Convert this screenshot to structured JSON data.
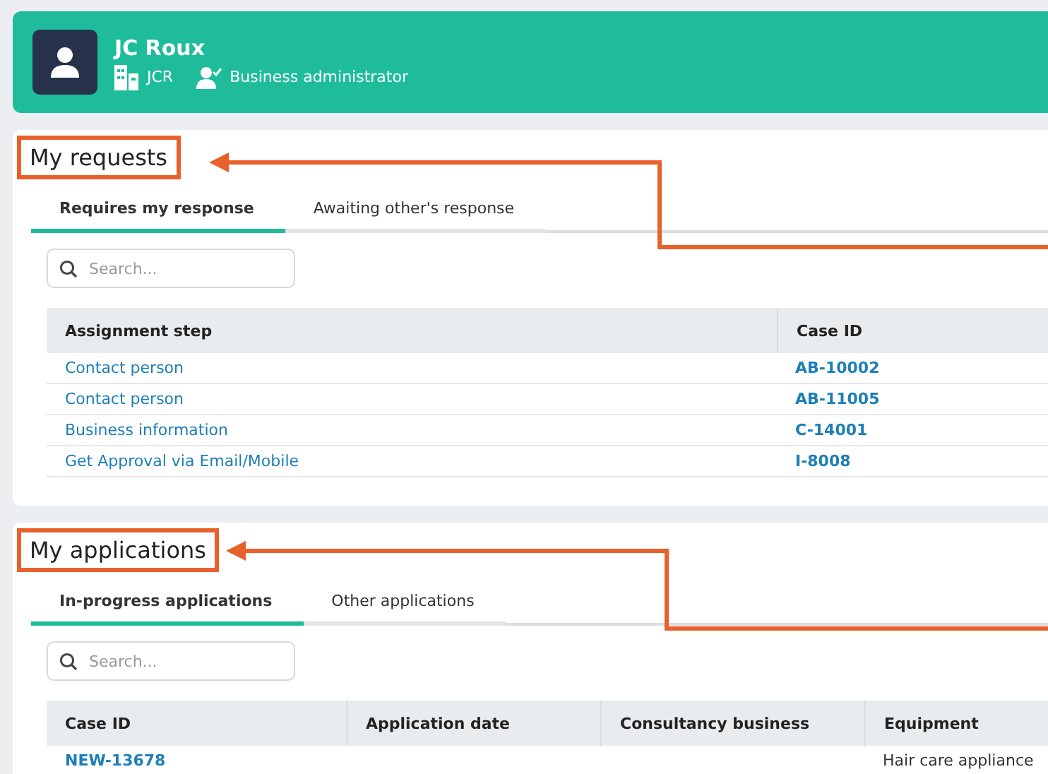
{
  "profile": {
    "name": "JC Roux",
    "organization": "JCR",
    "role": "Business administrator"
  },
  "sections": [
    {
      "title": "My requests",
      "tabs": [
        {
          "label": "Requires my response",
          "selected": true
        },
        {
          "label": "Awaiting other's response",
          "selected": false
        }
      ],
      "search": {
        "placeholder": "Search..."
      },
      "table": {
        "columns": [
          {
            "label": "Assignment step",
            "kind": "link"
          },
          {
            "label": "Case ID",
            "kind": "id"
          }
        ],
        "rows": [
          [
            "Contact person",
            "AB-10002"
          ],
          [
            "Contact person",
            "AB-11005"
          ],
          [
            "Business information",
            "C-14001"
          ],
          [
            "Get Approval via Email/Mobile",
            "I-8008"
          ]
        ]
      }
    },
    {
      "title": "My applications",
      "tabs": [
        {
          "label": "In-progress applications",
          "selected": true
        },
        {
          "label": "Other applications",
          "selected": false
        }
      ],
      "search": {
        "placeholder": "Search..."
      },
      "table": {
        "columns": [
          {
            "label": "Case ID",
            "kind": "id"
          },
          {
            "label": "Application date",
            "kind": "text"
          },
          {
            "label": "Consultancy business",
            "kind": "text"
          },
          {
            "label": "Equipment",
            "kind": "text"
          }
        ],
        "rows": [
          [
            "NEW-13678",
            null,
            null,
            "Hair care appliance"
          ]
        ]
      }
    }
  ]
}
